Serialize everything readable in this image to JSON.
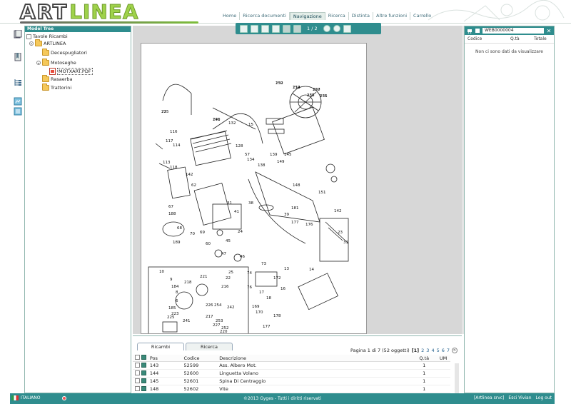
{
  "brand": {
    "logo_part1": "ART",
    "logo_part2": "LINEA"
  },
  "topnav": [
    {
      "label": "Home"
    },
    {
      "label": "Ricerca documenti"
    },
    {
      "label": "Navigazione"
    },
    {
      "label": "Ricerca"
    },
    {
      "label": "Distinta"
    },
    {
      "label": "Altre funzioni"
    },
    {
      "label": "Carrello"
    }
  ],
  "tree": {
    "title": "Model Tree",
    "root": "Tavole Ricambi",
    "brand_node": "ARTLINEA",
    "items": [
      "Decespugliatori",
      "Motoseghe",
      "MOTXART.PDF",
      "Rasaerba",
      "Trattorini"
    ]
  },
  "viewer": {
    "page_indicator": "1 / 2"
  },
  "drawing_labels": [
    "152",
    "154",
    "157",
    "156",
    "155",
    "72",
    "191",
    "132",
    "15",
    "116",
    "117",
    "114",
    "113",
    "118",
    "128",
    "57",
    "134",
    "138",
    "139",
    "145",
    "149",
    "148",
    "151",
    "142",
    "62",
    "67",
    "188",
    "68",
    "189",
    "69",
    "70",
    "60",
    "47",
    "45",
    "46",
    "24",
    "41",
    "31",
    "38",
    "39",
    "181",
    "177",
    "176",
    "142",
    "23",
    "31",
    "25",
    "22",
    "73",
    "74",
    "76",
    "13",
    "14",
    "172",
    "16",
    "17",
    "169",
    "170",
    "177",
    "178",
    "18",
    "10",
    "9",
    "184",
    "8",
    "6",
    "185",
    "223",
    "225",
    "221",
    "218",
    "216",
    "217",
    "253",
    "252",
    "254",
    "242",
    "226",
    "220",
    "227",
    "241",
    "230",
    "219",
    "220",
    "237",
    "236",
    "235",
    "240"
  ],
  "right_panel": {
    "doc_code": "WEB0000004",
    "col_codice": "Codice",
    "col_qta": "Q.tà",
    "col_totale": "Totale",
    "empty_msg": "Non ci sono dati da visualizzare"
  },
  "bottom": {
    "tabs": [
      "Ricambi",
      "Ricerca"
    ],
    "pagination": {
      "text": "Pagina 1 di 7 (52 oggetti)",
      "current": "[1]",
      "pages": [
        "2",
        "3",
        "4",
        "5",
        "6",
        "7"
      ],
      "next": ">"
    },
    "columns": {
      "pos": "Pos",
      "codice": "Codice",
      "descrizione": "Descrizione",
      "qta": "Q.tà",
      "um": "UM"
    },
    "rows": [
      {
        "pos": "143",
        "codice": "52599",
        "descrizione": "Ass. Albero Mot.",
        "qta": "1",
        "um": ""
      },
      {
        "pos": "144",
        "codice": "52600",
        "descrizione": "Linguetta Volano",
        "qta": "1",
        "um": ""
      },
      {
        "pos": "145",
        "codice": "52601",
        "descrizione": "Spina Di Centraggio",
        "qta": "1",
        "um": ""
      },
      {
        "pos": "148",
        "codice": "52602",
        "descrizione": "Vite",
        "qta": "1",
        "um": ""
      }
    ]
  },
  "footer": {
    "language": "ITALIANO",
    "copyright": "©2013 Gyges - Tutti i diritti riservati",
    "user": "[Artlinea srvc]",
    "exit": "Esci Vivian",
    "logout": "Log out"
  }
}
